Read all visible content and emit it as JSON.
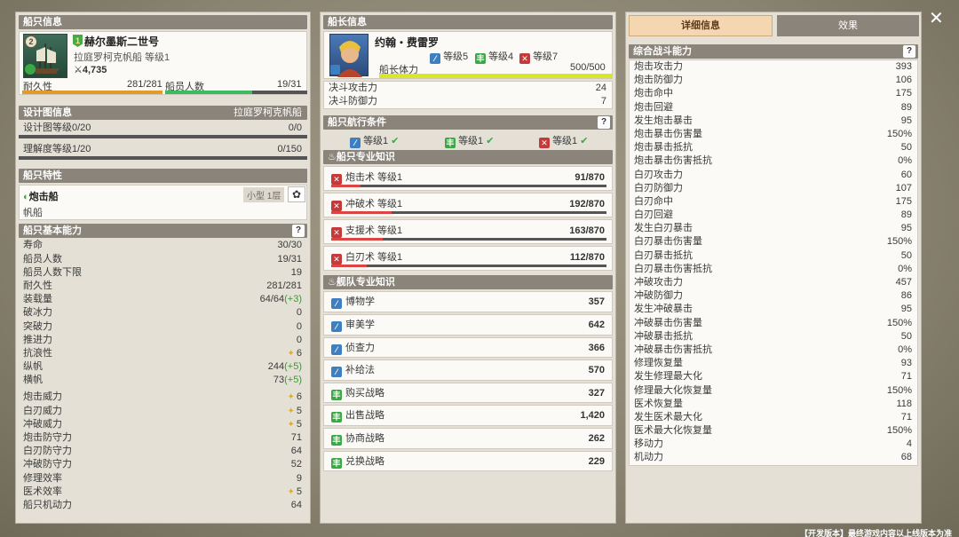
{
  "ship_info": {
    "header": "船只信息",
    "level_badge": "2",
    "rank_badge": "1",
    "name": "赫尔墨斯二世号",
    "subtitle": "拉庭罗柯克帆船 等级1",
    "power": "4,735",
    "durability_label": "耐久性",
    "durability_value": "281/281",
    "durability_pct": 100,
    "crew_label": "船员人数",
    "crew_value": "19/31",
    "crew_pct": 61
  },
  "design": {
    "header": "设计图信息",
    "header_right": "拉庭罗柯克帆船",
    "level_label": "设计图等级0/20",
    "level_value": "0/0",
    "understand_label": "理解度等级1/20",
    "understand_value": "0/150"
  },
  "trait": {
    "header": "船只特性",
    "name": "炮击船",
    "tag": "小型 1层",
    "type": "帆船"
  },
  "basic": {
    "header": "船只基本能力",
    "help": "?",
    "rows": [
      {
        "label": "寿命",
        "value": "30/30",
        "bonus": "",
        "star": false
      },
      {
        "label": "船员人数",
        "value": "19/31",
        "bonus": "",
        "star": false
      },
      {
        "label": "船员人数下限",
        "value": "19",
        "bonus": "",
        "star": false
      },
      {
        "label": "耐久性",
        "value": "281/281",
        "bonus": "",
        "star": false
      },
      {
        "label": "装载量",
        "value": "64/64",
        "bonus": "(+3)",
        "star": false
      },
      {
        "label": "破冰力",
        "value": "0",
        "bonus": "",
        "star": false
      },
      {
        "label": "突破力",
        "value": "0",
        "bonus": "",
        "star": false
      },
      {
        "label": "推进力",
        "value": "0",
        "bonus": "",
        "star": false
      },
      {
        "label": "抗浪性",
        "value": "6",
        "bonus": "",
        "star": true
      },
      {
        "label": "纵帆",
        "value": "244",
        "bonus": "(+5)",
        "star": false
      },
      {
        "label": "横帆",
        "value": "73",
        "bonus": "(+5)",
        "star": false
      }
    ],
    "rows2": [
      {
        "label": "炮击威力",
        "value": "6",
        "star": true
      },
      {
        "label": "白刃威力",
        "value": "5",
        "star": true
      },
      {
        "label": "冲破威力",
        "value": "5",
        "star": true
      },
      {
        "label": "炮击防守力",
        "value": "71",
        "star": false
      },
      {
        "label": "白刃防守力",
        "value": "64",
        "star": false
      },
      {
        "label": "冲破防守力",
        "value": "52",
        "star": false
      },
      {
        "label": "修理效率",
        "value": "9",
        "star": false
      },
      {
        "label": "医术效率",
        "value": "5",
        "star": true
      },
      {
        "label": "船只机动力",
        "value": "64",
        "star": false
      }
    ]
  },
  "captain": {
    "header": "船长信息",
    "name": "约翰・费雷罗",
    "lv1": "等级5",
    "lv2": "等级4",
    "lv3": "等级7",
    "stamina_label": "船长体力",
    "stamina_value": "500/500",
    "stamina_pct": 100,
    "atk_label": "决斗攻击力",
    "atk_value": "24",
    "def_label": "决斗防御力",
    "def_value": "7"
  },
  "sailing": {
    "header": "船只航行条件",
    "help": "?",
    "c1": "等级1",
    "c2": "等级1",
    "c3": "等级1"
  },
  "ship_skill": {
    "header": "船只专业知识",
    "rows": [
      {
        "label": "炮击术 等级1",
        "value": "91/870",
        "pct": 10.5
      },
      {
        "label": "冲破术 等级1",
        "value": "192/870",
        "pct": 22
      },
      {
        "label": "支援术 等级1",
        "value": "163/870",
        "pct": 18.7
      },
      {
        "label": "白刃术 等级1",
        "value": "112/870",
        "pct": 12.9
      }
    ]
  },
  "fleet_skill": {
    "header": "舰队专业知识",
    "rows": [
      {
        "label": "博物学",
        "value": "357",
        "icon": "b"
      },
      {
        "label": "审美学",
        "value": "642",
        "icon": "b"
      },
      {
        "label": "侦查力",
        "value": "366",
        "icon": "b"
      },
      {
        "label": "补给法",
        "value": "570",
        "icon": "b"
      },
      {
        "label": "购买战略",
        "value": "327",
        "icon": "g"
      },
      {
        "label": "出售战略",
        "value": "1,420",
        "icon": "g"
      },
      {
        "label": "协商战略",
        "value": "262",
        "icon": "g"
      },
      {
        "label": "兑换战略",
        "value": "229",
        "icon": "g"
      }
    ]
  },
  "tabs": {
    "detail": "详细信息",
    "effect": "效果"
  },
  "combat": {
    "header": "综合战斗能力",
    "help": "?",
    "rows": [
      {
        "label": "炮击攻击力",
        "value": "393"
      },
      {
        "label": "炮击防御力",
        "value": "106"
      },
      {
        "label": "炮击命中",
        "value": "175"
      },
      {
        "label": "炮击回避",
        "value": "89"
      },
      {
        "label": "发生炮击暴击",
        "value": "95"
      },
      {
        "label": "炮击暴击伤害量",
        "value": "150%"
      },
      {
        "label": "炮击暴击抵抗",
        "value": "50"
      },
      {
        "label": "炮击暴击伤害抵抗",
        "value": "0%"
      },
      {
        "label": "白刃攻击力",
        "value": "60"
      },
      {
        "label": "白刃防御力",
        "value": "107"
      },
      {
        "label": "白刃命中",
        "value": "175"
      },
      {
        "label": "白刃回避",
        "value": "89"
      },
      {
        "label": "发生白刃暴击",
        "value": "95"
      },
      {
        "label": "白刃暴击伤害量",
        "value": "150%"
      },
      {
        "label": "白刃暴击抵抗",
        "value": "50"
      },
      {
        "label": "白刃暴击伤害抵抗",
        "value": "0%"
      },
      {
        "label": "冲破攻击力",
        "value": "457"
      },
      {
        "label": "冲破防御力",
        "value": "86"
      },
      {
        "label": "发生冲破暴击",
        "value": "95"
      },
      {
        "label": "冲破暴击伤害量",
        "value": "150%"
      },
      {
        "label": "冲破暴击抵抗",
        "value": "50"
      },
      {
        "label": "冲破暴击伤害抵抗",
        "value": "0%"
      },
      {
        "label": "修理恢复量",
        "value": "93"
      },
      {
        "label": "发生修理最大化",
        "value": "71"
      },
      {
        "label": "修理最大化恢复量",
        "value": "150%"
      },
      {
        "label": "医术恢复量",
        "value": "118"
      },
      {
        "label": "发生医术最大化",
        "value": "71"
      },
      {
        "label": "医术最大化恢复量",
        "value": "150%"
      },
      {
        "label": "移动力",
        "value": "4"
      },
      {
        "label": "机动力",
        "value": "68"
      }
    ]
  },
  "footer": "【开发版本】最终游戏内容以上线版本为准",
  "close": "✕"
}
